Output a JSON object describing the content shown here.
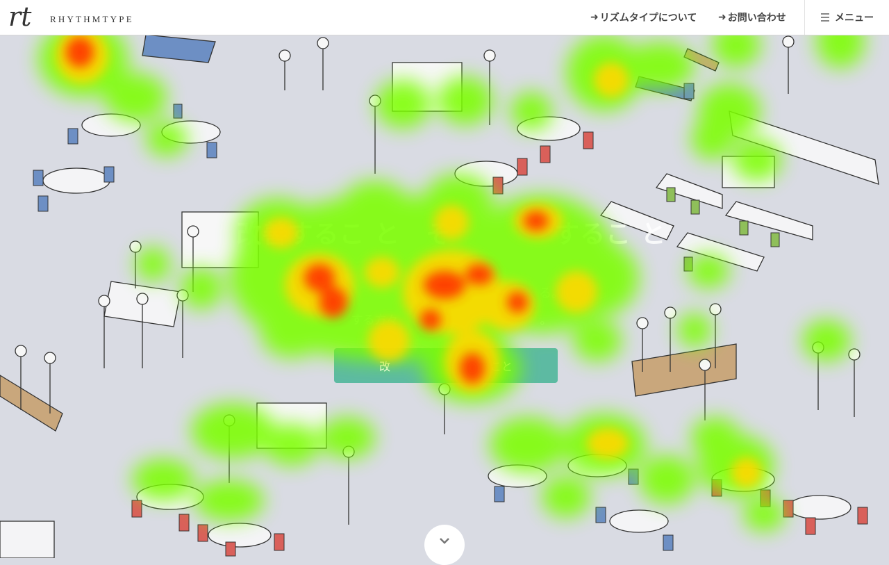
{
  "header": {
    "logo_mark": "rt",
    "logo_text": "RHYTHMTYPE",
    "nav": [
      {
        "label": "リズムタイプについて",
        "icon": "arrow-right-icon"
      },
      {
        "label": "お問い合わせ",
        "icon": "arrow-right-icon"
      }
    ],
    "menu_label": "メニュー"
  },
  "hero": {
    "title": "改善するこ と　そ　　　　するこ と",
    "subtitle": "　　　　　　　　　　　　　　　　る。",
    "subtitle2": "する方々　　　　　　　　　　　　。",
    "cta_label": "改　　　　　　　　　こと"
  },
  "colors": {
    "background": "#d9dbe3",
    "cta": "#46b496",
    "heat_low": "#7cff00",
    "heat_mid": "#ffd800",
    "heat_high": "#ff2a00"
  },
  "scroll_icon": "chevron-down-icon"
}
